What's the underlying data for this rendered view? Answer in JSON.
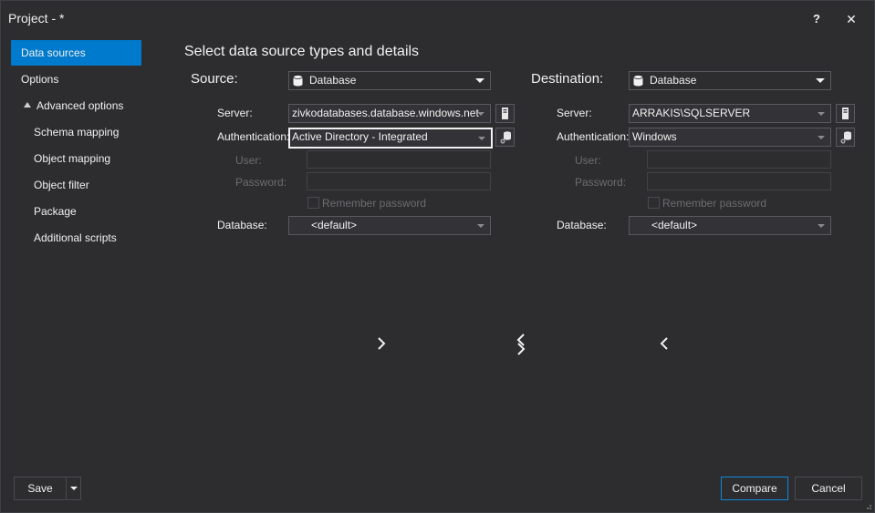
{
  "window": {
    "title": "Project - *",
    "help_label": "?",
    "close_label": "✕"
  },
  "nav": {
    "items": [
      {
        "label": "Data sources"
      },
      {
        "label": "Options"
      },
      {
        "label": "Advanced options"
      },
      {
        "label": "Schema mapping"
      },
      {
        "label": "Object mapping"
      },
      {
        "label": "Object filter"
      },
      {
        "label": "Package"
      },
      {
        "label": "Additional scripts"
      }
    ]
  },
  "main": {
    "heading": "Select data source types and details",
    "source": {
      "label": "Source:",
      "type": "Database",
      "server_label": "Server:",
      "server": "zivkodatabases.database.windows.net",
      "auth_label": "Authentication:",
      "auth": "Active Directory - Integrated",
      "user_label": "User:",
      "user": "",
      "password_label": "Password:",
      "password": "",
      "remember_label": "Remember password",
      "database_label": "Database:",
      "database": "<default>"
    },
    "destination": {
      "label": "Destination:",
      "type": "Database",
      "server_label": "Server:",
      "server": "ARRAKIS\\SQLSERVER",
      "auth_label": "Authentication:",
      "auth": "Windows",
      "user_label": "User:",
      "user": "",
      "password_label": "Password:",
      "password": "",
      "remember_label": "Remember password",
      "database_label": "Database:",
      "database": "<default>"
    }
  },
  "footer": {
    "save_label": "Save",
    "compare_label": "Compare",
    "cancel_label": "Cancel"
  },
  "colors": {
    "accent": "#007acc",
    "background": "#2d2d30",
    "text": "#f1f1f1",
    "dim_text": "#6d6d70"
  }
}
